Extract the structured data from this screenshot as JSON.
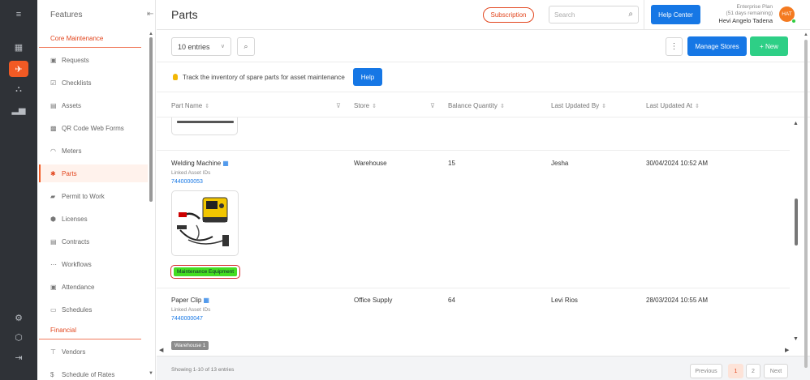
{
  "rail": {
    "icons": [
      "collapse-menu-icon",
      "dashboard-icon",
      "maintenance-icon",
      "org-chart-icon",
      "analytics-icon",
      "settings-icon",
      "cube-icon",
      "logout-icon"
    ]
  },
  "sidebar": {
    "header": "Features",
    "sections": [
      {
        "title": "Core Maintenance"
      },
      {
        "title": "Financial"
      }
    ],
    "items": [
      {
        "label": "Requests",
        "icon": "requests-icon"
      },
      {
        "label": "Checklists",
        "icon": "checklist-icon"
      },
      {
        "label": "Assets",
        "icon": "assets-icon"
      },
      {
        "label": "QR Code Web Forms",
        "icon": "qr-code-icon"
      },
      {
        "label": "Meters",
        "icon": "meter-icon"
      },
      {
        "label": "Parts",
        "icon": "parts-icon",
        "active": true
      },
      {
        "label": "Permit to Work",
        "icon": "permit-icon"
      },
      {
        "label": "Licenses",
        "icon": "license-icon"
      },
      {
        "label": "Contracts",
        "icon": "contract-icon"
      },
      {
        "label": "Workflows",
        "icon": "workflow-icon"
      },
      {
        "label": "Attendance",
        "icon": "attendance-icon"
      },
      {
        "label": "Schedules",
        "icon": "calendar-icon"
      },
      {
        "label": "Vendors",
        "icon": "vendor-icon"
      },
      {
        "label": "Schedule of Rates",
        "icon": "dollar-icon"
      }
    ]
  },
  "header": {
    "title": "Parts",
    "subscription_label": "Subscription",
    "search_placeholder": "Search",
    "help_center_label": "Help Center",
    "plan_name": "Enterprise Plan",
    "plan_days": "(51 days remaining)",
    "user_name": "Hevi Angelo Tadena",
    "avatar_initials": "HAT"
  },
  "toolbar": {
    "entries_label": "10 entries",
    "manage_stores_label": "Manage Stores",
    "new_label": "+ New"
  },
  "info": {
    "text": "Track the inventory of spare parts for asset maintenance",
    "help_label": "Help"
  },
  "table": {
    "columns": [
      "Part Name",
      "Store",
      "Balance Quantity",
      "Last Updated By",
      "Last Updated At"
    ],
    "rows": [
      {
        "part_name": "Welding Machine",
        "linked_label": "Linked Asset IDs",
        "asset_id": "7440000053",
        "store": "Warehouse",
        "qty": "15",
        "updated_by": "Jesha",
        "updated_at": "30/04/2024 10:52 AM",
        "tag": "Maintenance Equipment",
        "tag_color": "#44dd22"
      },
      {
        "part_name": "Paper Clip",
        "linked_label": "Linked Asset IDs",
        "asset_id": "7440000047",
        "store": "Office Supply",
        "qty": "64",
        "updated_by": "Levi Rios",
        "updated_at": "28/03/2024 10:55 AM",
        "tag": "Warehouse 1",
        "tag_color": "#8c8c8c"
      }
    ]
  },
  "footer": {
    "showing": "Showing 1-10 of 13 entries",
    "prev_label": "Previous",
    "pages": [
      "1",
      "2"
    ],
    "next_label": "Next"
  },
  "colors": {
    "accent": "#f15a24",
    "primary": "#1677e5",
    "success": "#2ecf86",
    "rail_bg": "#2f3237"
  }
}
